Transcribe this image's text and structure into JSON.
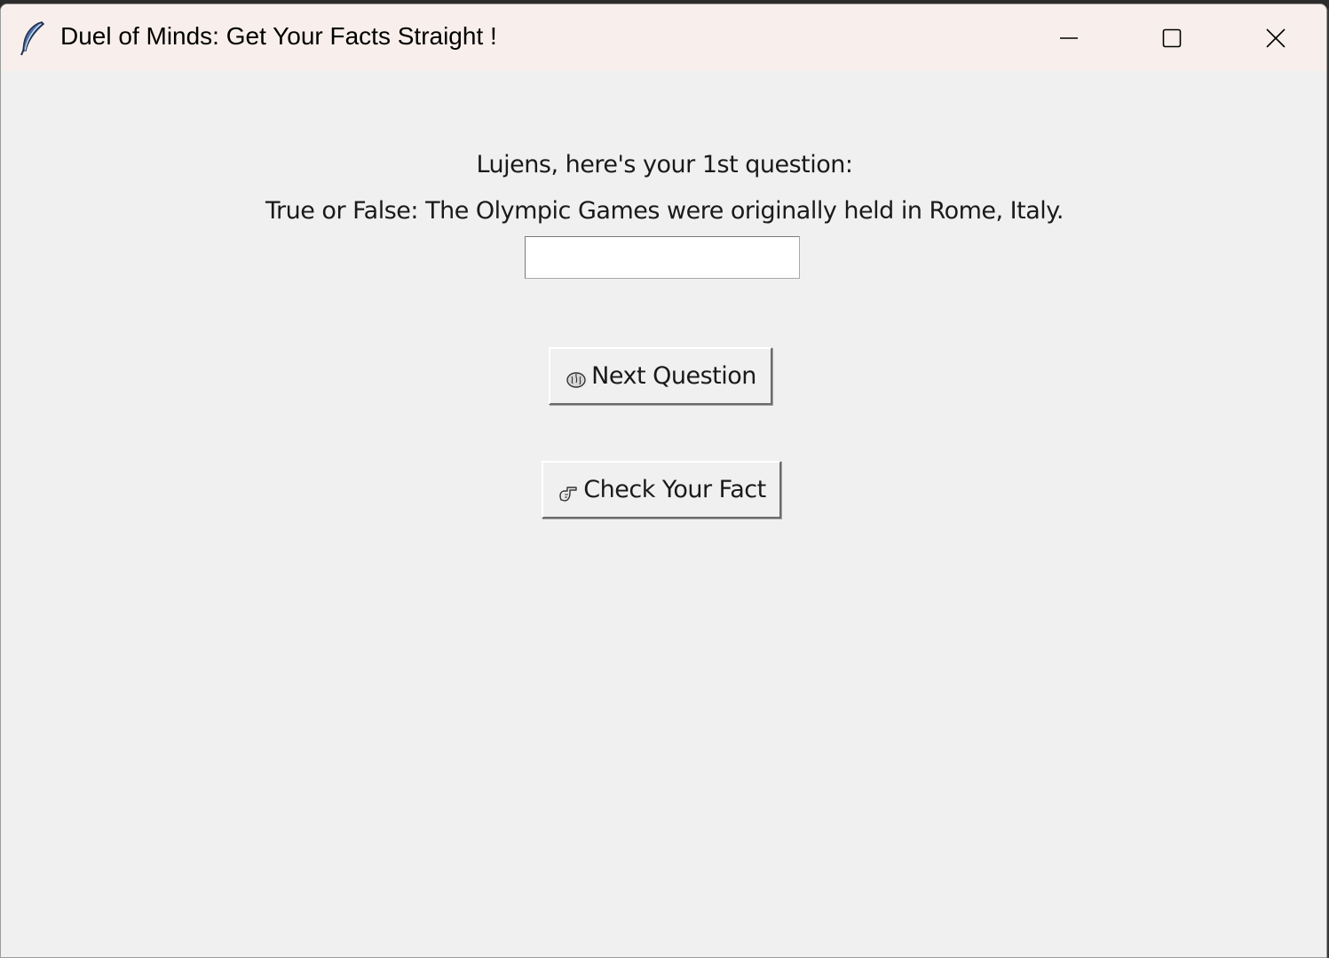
{
  "window": {
    "title": "Duel of Minds: Get Your Facts Straight !",
    "app_icon": "feather-icon",
    "controls": {
      "minimize_icon": "minimize-icon",
      "maximize_icon": "maximize-icon",
      "close_icon": "close-icon"
    }
  },
  "quiz": {
    "greeting": "Lujens, here's your 1st question:",
    "question": "True or False: The Olympic Games were originally held in Rome, Italy.",
    "answer_value": ""
  },
  "buttons": {
    "next_label": "Next Question",
    "next_icon": "brain-icon",
    "check_label": "Check Your Fact",
    "check_icon": "pointing-hand-icon"
  },
  "colors": {
    "titlebar_bg": "#f8efec",
    "window_bg": "#f0f0f0",
    "text": "#1a1a1a"
  }
}
